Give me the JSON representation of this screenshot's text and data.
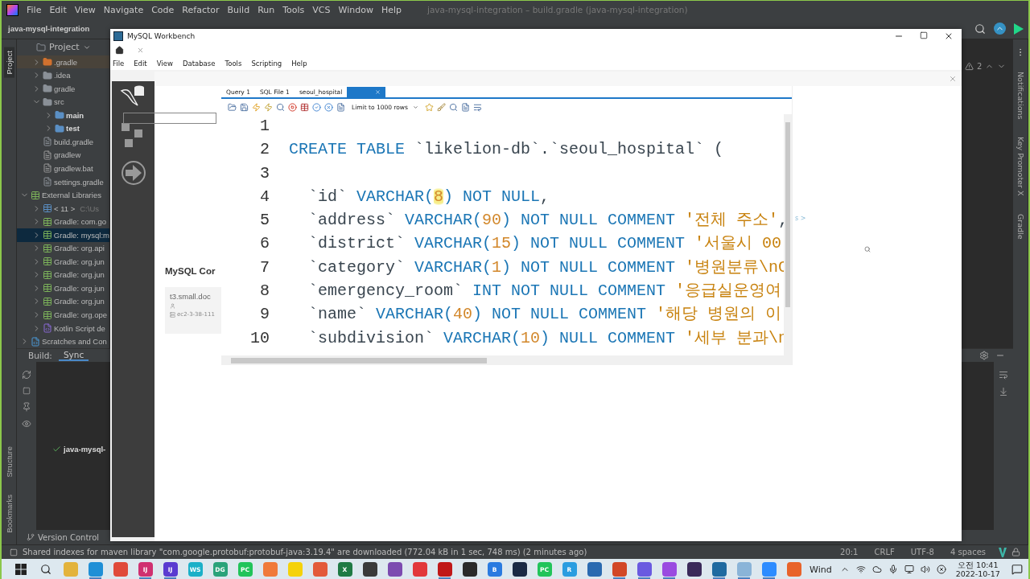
{
  "ide": {
    "menu": [
      "File",
      "Edit",
      "View",
      "Navigate",
      "Code",
      "Refactor",
      "Build",
      "Run",
      "Tools",
      "VCS",
      "Window",
      "Help"
    ],
    "title": "java-mysql-integration – build.gradle (java-mysql-integration)",
    "breadcrumb": "java-mysql-integration",
    "left_stripe_top": [
      {
        "label": "Project",
        "selected": true
      }
    ],
    "left_stripe_bottom": [
      {
        "label": "Structure",
        "selected": false
      },
      {
        "label": "Bookmarks",
        "selected": false
      }
    ],
    "project_panel": {
      "title": "Project",
      "project_contents": [
        {
          "label": ".gradle",
          "kind": "excluded",
          "expanded": false,
          "selected": false
        },
        {
          "label": ".idea",
          "kind": "folder",
          "expanded": false,
          "selected": false
        },
        {
          "label": "gradle",
          "kind": "folder",
          "expanded": false,
          "selected": false
        },
        {
          "label": "src",
          "kind": "folder",
          "expanded": true,
          "selected": false,
          "children": [
            {
              "label": "main",
              "kind": "module",
              "expanded": false,
              "selected": false
            },
            {
              "label": "test",
              "kind": "module",
              "expanded": false,
              "selected": false
            }
          ]
        },
        {
          "label": "build.gradle",
          "kind": "gradle",
          "selected": false
        },
        {
          "label": "gradlew",
          "kind": "script",
          "selected": false
        },
        {
          "label": "gradlew.bat",
          "kind": "bat",
          "selected": false
        },
        {
          "label": "settings.gradle",
          "kind": "gradle",
          "selected": false
        }
      ],
      "tree": [
        {
          "label": "External Libraries",
          "kind": "libraries",
          "expanded": true,
          "selected": false,
          "children": [
            {
              "label": "< 11 >",
              "suffix": "C:\\Us",
              "kind": "jdk",
              "expanded": false,
              "selected": false
            },
            {
              "label": "Gradle: com.go",
              "kind": "library",
              "expanded": false,
              "selected": false
            },
            {
              "label": "Gradle: mysql:m",
              "kind": "library",
              "expanded": false,
              "selected": true
            },
            {
              "label": "Gradle: org.api",
              "kind": "library",
              "expanded": false,
              "selected": false
            },
            {
              "label": "Gradle: org.jun",
              "kind": "library",
              "expanded": false,
              "selected": false
            },
            {
              "label": "Gradle: org.jun",
              "kind": "library",
              "expanded": false,
              "selected": false
            },
            {
              "label": "Gradle: org.jun",
              "kind": "library",
              "expanded": false,
              "selected": false
            },
            {
              "label": "Gradle: org.jun",
              "kind": "library",
              "expanded": false,
              "selected": false
            },
            {
              "label": "Gradle: org.ope",
              "kind": "library",
              "expanded": false,
              "selected": false
            },
            {
              "label": "Kotlin Script de",
              "kind": "kotlin",
              "expanded": false,
              "selected": false
            }
          ]
        },
        {
          "label": "Scratches and Con",
          "kind": "scratches",
          "expanded": false,
          "selected": false
        }
      ]
    },
    "build_panel": {
      "label": "Build:",
      "tabs": [
        {
          "label": "Sync",
          "selected": true
        }
      ],
      "items": [
        {
          "label": "java-mysql-",
          "kind": "success"
        }
      ]
    },
    "version_control": "Version Control",
    "inspections": {
      "count": "2"
    },
    "right_stripe": [
      "Notifications",
      "Key Promoter X",
      "Gradle"
    ],
    "status_bar": {
      "message": "Shared indexes for maven library \"com.google.protobuf:protobuf-java:3.19.4\" are downloaded (772.04 kB in 1 sec, 748 ms) (2 minutes ago)",
      "items": [
        "20:1",
        "CRLF",
        "UTF-8",
        "4 spaces"
      ]
    }
  },
  "workbench": {
    "title": "MySQL Workbench",
    "menu": [
      "File",
      "Edit",
      "View",
      "Database",
      "Tools",
      "Scripting",
      "Help"
    ],
    "home_heading": "MySQL Cor",
    "connection": {
      "name": "t3.small.doc",
      "host": "ec2-3-38-111"
    },
    "query_tabs": [
      {
        "label": "Query 1",
        "selected": false
      },
      {
        "label": "SQL File 1",
        "selected": false
      },
      {
        "label": "seoul_hospital",
        "selected": false
      },
      {
        "selected": true
      }
    ],
    "limit_select": "Limit to 1000 rows",
    "code_lines": [
      {
        "number": "1"
      },
      {
        "number": "2",
        "tokens": [
          {
            "kind": "keyword",
            "text": "CREATE TABLE"
          },
          {
            "kind": "identifier",
            "text": " `likelion-db`.`seoul_hospital` ("
          }
        ]
      },
      {
        "number": "3"
      },
      {
        "number": "4",
        "tokens": [
          {
            "kind": "identifier",
            "text": "  `id` "
          },
          {
            "kind": "keyword",
            "text": "VARCHAR("
          },
          {
            "kind": "number",
            "text": "8",
            "highlight": true
          },
          {
            "kind": "keyword",
            "text": ") NOT NULL"
          },
          {
            "kind": "identifier",
            "text": ","
          }
        ]
      },
      {
        "number": "5",
        "tokens": [
          {
            "kind": "identifier",
            "text": "  `address` "
          },
          {
            "kind": "keyword",
            "text": "VARCHAR("
          },
          {
            "kind": "number",
            "text": "90"
          },
          {
            "kind": "keyword",
            "text": ") NOT NULL COMMENT "
          },
          {
            "kind": "string",
            "text": "'전체 주소'"
          },
          {
            "kind": "identifier",
            "text": ","
          }
        ]
      },
      {
        "number": "6",
        "tokens": [
          {
            "kind": "identifier",
            "text": "  `district` "
          },
          {
            "kind": "keyword",
            "text": "VARCHAR("
          },
          {
            "kind": "number",
            "text": "15"
          },
          {
            "kind": "keyword",
            "text": ") NOT NULL COMMENT "
          },
          {
            "kind": "string",
            "text": "'서울시 00"
          }
        ]
      },
      {
        "number": "7",
        "tokens": [
          {
            "kind": "identifier",
            "text": "  `category` "
          },
          {
            "kind": "keyword",
            "text": "VARCHAR("
          },
          {
            "kind": "number",
            "text": "1"
          },
          {
            "kind": "keyword",
            "text": ") NOT NULL COMMENT "
          },
          {
            "kind": "string",
            "text": "'병원분류\\nC"
          }
        ]
      },
      {
        "number": "8",
        "tokens": [
          {
            "kind": "identifier",
            "text": "  `emergency_room` "
          },
          {
            "kind": "keyword",
            "text": "INT NOT NULL COMMENT "
          },
          {
            "kind": "string",
            "text": "'응급실운영여"
          }
        ]
      },
      {
        "number": "9",
        "tokens": [
          {
            "kind": "identifier",
            "text": "  `name` "
          },
          {
            "kind": "keyword",
            "text": "VARCHAR("
          },
          {
            "kind": "number",
            "text": "40"
          },
          {
            "kind": "keyword",
            "text": ") NOT NULL COMMENT "
          },
          {
            "kind": "string",
            "text": "'해당 병원의 이"
          }
        ]
      },
      {
        "number": "10",
        "tokens": [
          {
            "kind": "identifier",
            "text": "  `subdivision` "
          },
          {
            "kind": "keyword",
            "text": "VARCHAR("
          },
          {
            "kind": "number",
            "text": "10"
          },
          {
            "kind": "keyword",
            "text": ") NULL COMMENT "
          },
          {
            "kind": "string",
            "text": "'세부 분과\\n"
          }
        ]
      }
    ],
    "side_hint": "s >"
  },
  "taskbar": {
    "apps": [
      {
        "color": "#e3b33c",
        "running": false
      },
      {
        "color": "#1f8fd6",
        "running": true
      },
      {
        "color": "#e04a3a",
        "running": false
      },
      {
        "color": "#d03070",
        "glyph": "IJ",
        "running": true
      },
      {
        "color": "#5a3bd0",
        "glyph": "IJ",
        "running": true
      },
      {
        "color": "#1bb0c8",
        "glyph": "WS",
        "running": false
      },
      {
        "color": "#2aa37a",
        "glyph": "DG",
        "running": false
      },
      {
        "color": "#21c45a",
        "glyph": "PC",
        "running": false
      },
      {
        "color": "#f07a3a",
        "running": false
      },
      {
        "color": "#f5d20a",
        "running": false
      },
      {
        "color": "#e35a3a",
        "running": false
      },
      {
        "color": "#1f7a44",
        "glyph": "X",
        "running": false
      },
      {
        "color": "#3a3a3a",
        "running": false
      },
      {
        "color": "#7c4bb0",
        "running": false
      },
      {
        "color": "#e2383a",
        "running": false
      },
      {
        "color": "#c01818",
        "running": true
      },
      {
        "color": "#2a2a2a",
        "running": false
      },
      {
        "color": "#2a7be0",
        "glyph": "B",
        "running": false
      },
      {
        "color": "#1a2a44",
        "running": false
      },
      {
        "color": "#21c45a",
        "glyph": "PC",
        "running": false
      },
      {
        "color": "#2a9de0",
        "glyph": "R",
        "running": false
      },
      {
        "color": "#2a6ab0",
        "running": false
      },
      {
        "color": "#d24726",
        "running": true
      },
      {
        "color": "#6a5ae0",
        "running": true
      },
      {
        "color": "#9a4be0",
        "running": true
      },
      {
        "color": "#3a2a5a",
        "running": false
      },
      {
        "color": "#1f6aa0",
        "running": true
      },
      {
        "color": "#8ab4d8",
        "running": true
      },
      {
        "color": "#2d8cff",
        "running": true
      },
      {
        "color": "#e8632a",
        "running": false
      }
    ],
    "tray_label": "Wind",
    "time": "오전 10:41",
    "date": "2022-10-17"
  }
}
